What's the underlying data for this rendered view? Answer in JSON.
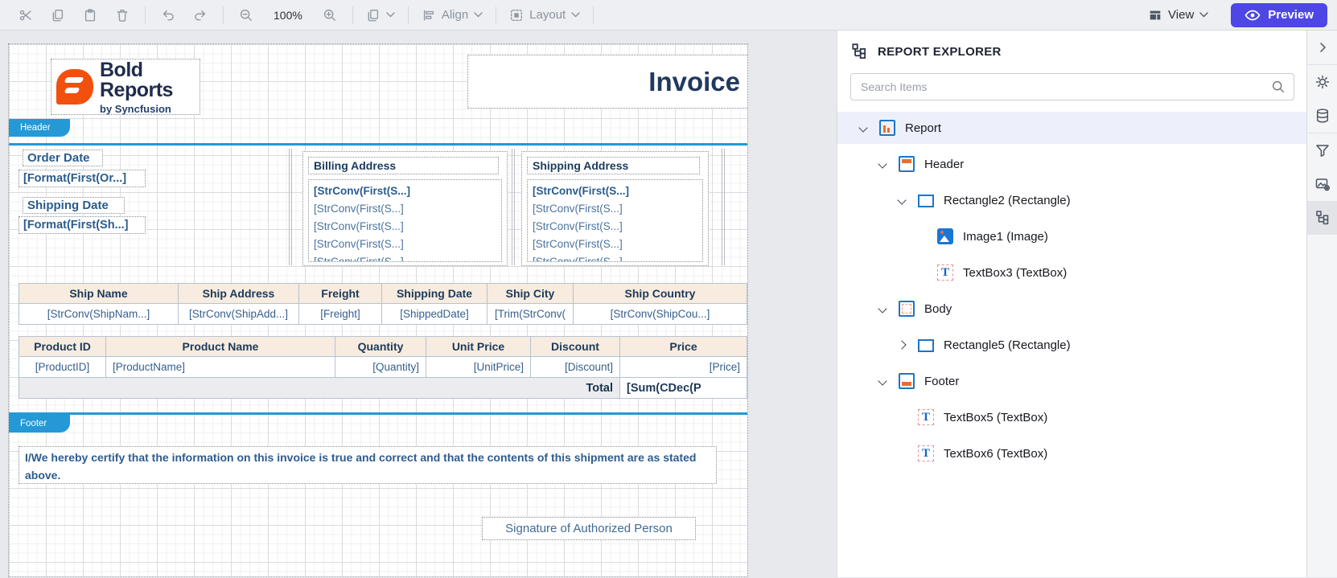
{
  "toolbar": {
    "zoom_level": "100%",
    "align_label": "Align",
    "layout_label": "Layout",
    "view_label": "View",
    "preview_label": "Preview"
  },
  "explorer": {
    "title": "REPORT EXPLORER",
    "search_placeholder": "Search Items",
    "tree": [
      {
        "label": "Report",
        "level": 0,
        "chevron": "down",
        "icon": "report",
        "selected": true
      },
      {
        "label": "Header",
        "level": 1,
        "chevron": "down",
        "icon": "header",
        "selected": false
      },
      {
        "label": "Rectangle2 (Rectangle)",
        "level": 2,
        "chevron": "down",
        "icon": "rectangle",
        "selected": false
      },
      {
        "label": "Image1 (Image)",
        "level": 3,
        "chevron": "none",
        "icon": "image",
        "selected": false
      },
      {
        "label": "TextBox3 (TextBox)",
        "level": 3,
        "chevron": "none",
        "icon": "textbox",
        "selected": false
      },
      {
        "label": "Body",
        "level": 1,
        "chevron": "down",
        "icon": "body",
        "selected": false
      },
      {
        "label": "Rectangle5 (Rectangle)",
        "level": 2,
        "chevron": "right",
        "icon": "rectangle",
        "selected": false
      },
      {
        "label": "Footer",
        "level": 1,
        "chevron": "down",
        "icon": "footer",
        "selected": false
      },
      {
        "label": "TextBox5 (TextBox)",
        "level": 2,
        "chevron": "none",
        "icon": "textbox",
        "selected": false
      },
      {
        "label": "TextBox6 (TextBox)",
        "level": 2,
        "chevron": "none",
        "icon": "textbox",
        "selected": false
      }
    ]
  },
  "report": {
    "logo": {
      "brand_bold": "Bold",
      "brand_regular": "Reports",
      "tagline": "by Syncfusion"
    },
    "title": "Invoice",
    "header_tab": "Header",
    "footer_tab": "Footer",
    "fields": {
      "order_date_label": "Order Date",
      "order_date_value": "[Format(First(Or...]",
      "shipping_date_label": "Shipping Date",
      "shipping_date_value": "[Format(First(Sh...]",
      "billing_address_label": "Billing Address",
      "shipping_address_label": "Shipping Address",
      "address_line_bold": "[StrConv(First(S...]",
      "address_line": "[StrConv(First(S...]"
    },
    "ship_table": {
      "headers": [
        "Ship Name",
        "Ship Address",
        "Freight",
        "Shipping Date",
        "Ship City",
        "Ship Country"
      ],
      "row": [
        "[StrConv(ShipNam...]",
        "[StrConv(ShipAdd...]",
        "[Freight]",
        "[ShippedDate]",
        "[Trim(StrConv(",
        "[StrConv(ShipCou...]"
      ]
    },
    "product_table": {
      "headers": [
        "Product ID",
        "Product Name",
        "Quantity",
        "Unit Price",
        "Discount",
        "Price"
      ],
      "row": [
        "[ProductID]",
        "[ProductName]",
        "[Quantity]",
        "[UnitPrice]",
        "[Discount]",
        "[Price]"
      ],
      "total_label": "Total",
      "total_value": "[Sum(CDec(P"
    },
    "certify_text": "I/We hereby certify that the information on this invoice is true and correct and that the contents of this shipment are as stated above.",
    "signature_label": "Signature of Authorized Person"
  },
  "colors": {
    "accent_blue": "#2499d6",
    "preview_button": "#4e46e5",
    "brand_orange": "#f2500f",
    "report_navy": "#2a5b8c",
    "table_header_bg": "#f7ecdf",
    "selected_tree_row": "#edf0fa"
  }
}
